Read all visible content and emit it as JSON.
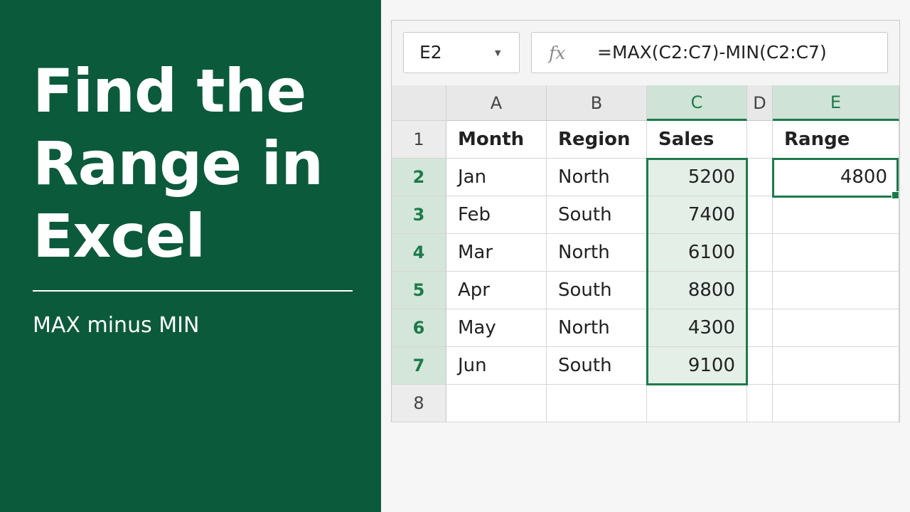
{
  "left_panel": {
    "title_lines": [
      "Find the",
      "Range in",
      "Excel"
    ],
    "subtitle": "MAX minus MIN",
    "background": "#0b5a3b"
  },
  "spreadsheet": {
    "name_box": "E2",
    "name_box_dropdown_icon": "chevron-down-icon",
    "fx_label": "fx",
    "formula": "=MAX(C2:C7)-MIN(C2:C7)",
    "columns": [
      "A",
      "B",
      "C",
      "D",
      "E"
    ],
    "selected_columns": [
      "C",
      "E"
    ],
    "rows": [
      "1",
      "2",
      "3",
      "4",
      "5",
      "6",
      "7",
      "8"
    ],
    "selected_rows": [
      "2",
      "3",
      "4",
      "5",
      "6",
      "7"
    ],
    "headers": {
      "A": "Month",
      "B": "Region",
      "C": "Sales",
      "D": "",
      "E": "Range"
    },
    "data": [
      {
        "month": "Jan",
        "region": "North",
        "sales": "5200",
        "range": "4800"
      },
      {
        "month": "Feb",
        "region": "South",
        "sales": "7400",
        "range": ""
      },
      {
        "month": "Mar",
        "region": "North",
        "sales": "6100",
        "range": ""
      },
      {
        "month": "Apr",
        "region": "South",
        "sales": "8800",
        "range": ""
      },
      {
        "month": "May",
        "region": "North",
        "sales": "4300",
        "range": ""
      },
      {
        "month": "Jun",
        "region": "South",
        "sales": "9100",
        "range": ""
      }
    ],
    "accent_color": "#1d7a4a",
    "selection_fill": "#e4efe7"
  }
}
